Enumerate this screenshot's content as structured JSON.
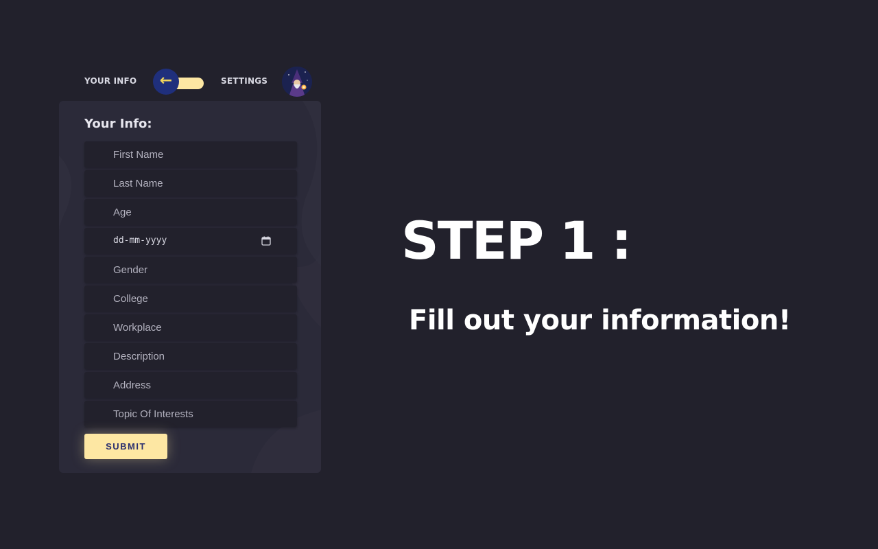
{
  "switcher": {
    "left_label": "YOUR INFO",
    "right_label": "SETTINGS",
    "knob_glyph": "←",
    "knob_icon": "arrow-left-icon",
    "avatar_icon": "wizard-avatar"
  },
  "form": {
    "title": "Your Info:",
    "fields": [
      {
        "placeholder": "First Name",
        "value": ""
      },
      {
        "placeholder": "Last Name",
        "value": ""
      },
      {
        "placeholder": "Age",
        "value": ""
      },
      {
        "placeholder": "dd-mm-yyyy",
        "value": "",
        "type": "date"
      },
      {
        "placeholder": "Gender",
        "value": ""
      },
      {
        "placeholder": "College",
        "value": ""
      },
      {
        "placeholder": "Workplace",
        "value": ""
      },
      {
        "placeholder": "Description",
        "value": ""
      },
      {
        "placeholder": "Address",
        "value": ""
      },
      {
        "placeholder": "Topic Of Interests",
        "value": ""
      }
    ],
    "submit_label": "SUBMIT",
    "date_icon": "calendar-icon"
  },
  "intro": {
    "heading": "STEP 1 :",
    "subheading": "Fill out your information!"
  },
  "colors": {
    "background": "#22212c",
    "card": "#2b2a39",
    "accent_yellow": "#fde7a3",
    "knob_blue": "#1f2f7c"
  }
}
